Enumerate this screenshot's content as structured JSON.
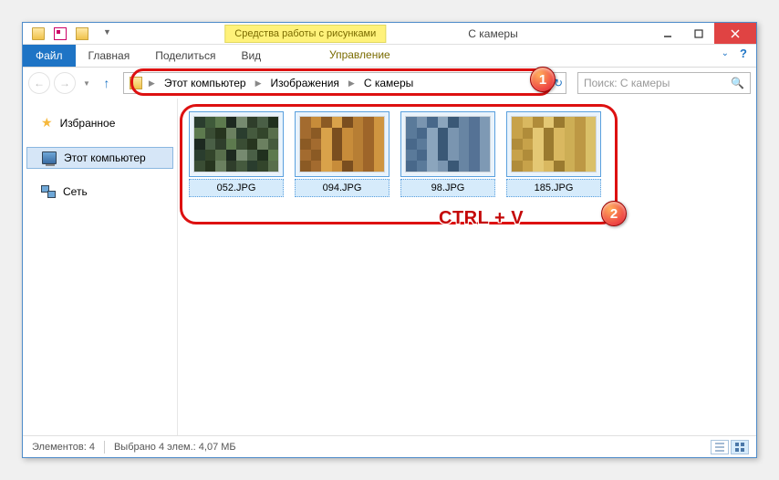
{
  "title": "С камеры",
  "contextual_tab": "Средства работы с рисунками",
  "ribbon": {
    "file": "Файл",
    "home": "Главная",
    "share": "Поделиться",
    "view": "Вид",
    "manage": "Управление"
  },
  "breadcrumb": {
    "root": "Этот компьютер",
    "pictures": "Изображения",
    "folder": "С камеры"
  },
  "search": {
    "placeholder": "Поиск: С камеры"
  },
  "sidebar": {
    "favorites": "Избранное",
    "this_pc": "Этот компьютер",
    "network": "Сеть"
  },
  "files": [
    {
      "name": "052.JPG"
    },
    {
      "name": "094.JPG"
    },
    {
      "name": "98.JPG"
    },
    {
      "name": "185.JPG"
    }
  ],
  "status": {
    "count_label": "Элементов: 4",
    "selection_label": "Выбрано 4 элем.: 4,07 МБ"
  },
  "annotations": {
    "keyhint": "CTRL + V",
    "badge1": "1",
    "badge2": "2"
  },
  "thumb_palettes": [
    [
      "#2a3d2e",
      "#3f5a3a",
      "#5d7a4e",
      "#1d2920",
      "#768a70",
      "#2f3e2b",
      "#4a5f46",
      "#20301e",
      "#5d7a4e",
      "#3a4d34",
      "#27351f",
      "#6b8060",
      "#2a3d2e",
      "#455a3e",
      "#33452b",
      "#586e4c",
      "#1d2920",
      "#4a5f46",
      "#2f3e2b",
      "#5d7a4e",
      "#3a4d34",
      "#27351f",
      "#6b8060",
      "#455a3e",
      "#2a3d2e",
      "#33452b",
      "#586e4c",
      "#1d2920",
      "#768a70",
      "#4a5f46",
      "#20301e",
      "#5d7a4e",
      "#3a4d34",
      "#27351f",
      "#6b8060",
      "#2f3e2b",
      "#455a3e",
      "#2a3d2e",
      "#33452b",
      "#586e4c"
    ],
    [
      "#a36b2f",
      "#c78c3a",
      "#8b5a24",
      "#d9a24a",
      "#7a4e1f",
      "#b77e34",
      "#9e6529",
      "#cf9540",
      "#a36b2f",
      "#8b5a24",
      "#d9a24a",
      "#7a4e1f",
      "#c78c3a",
      "#b77e34",
      "#9e6529",
      "#cf9540",
      "#8b5a24",
      "#a36b2f",
      "#d9a24a",
      "#7a4e1f",
      "#c78c3a",
      "#b77e34",
      "#9e6529",
      "#cf9540",
      "#a36b2f",
      "#8b5a24",
      "#d9a24a",
      "#7a4e1f",
      "#c78c3a",
      "#b77e34",
      "#9e6529",
      "#cf9540",
      "#8b5a24",
      "#a36b2f",
      "#d9a24a",
      "#c78c3a",
      "#7a4e1f",
      "#b77e34",
      "#9e6529",
      "#cf9540"
    ],
    [
      "#5a7a9a",
      "#7a95b0",
      "#48688a",
      "#8ba5bd",
      "#3a5876",
      "#6885a3",
      "#557295",
      "#7e99b4",
      "#5a7a9a",
      "#48688a",
      "#8ba5bd",
      "#3a5876",
      "#7a95b0",
      "#6885a3",
      "#557295",
      "#7e99b4",
      "#48688a",
      "#5a7a9a",
      "#8ba5bd",
      "#3a5876",
      "#7a95b0",
      "#6885a3",
      "#557295",
      "#7e99b4",
      "#5a7a9a",
      "#48688a",
      "#8ba5bd",
      "#3a5876",
      "#7a95b0",
      "#6885a3",
      "#557295",
      "#7e99b4",
      "#48688a",
      "#5a7a9a",
      "#8ba5bd",
      "#7a95b0",
      "#3a5876",
      "#6885a3",
      "#557295",
      "#7e99b4"
    ],
    [
      "#c7a24a",
      "#d9b860",
      "#b08c3a",
      "#e4c874",
      "#9a7a2f",
      "#cdae55",
      "#bd9844",
      "#dac068",
      "#c7a24a",
      "#b08c3a",
      "#e4c874",
      "#9a7a2f",
      "#d9b860",
      "#cdae55",
      "#bd9844",
      "#dac068",
      "#b08c3a",
      "#c7a24a",
      "#e4c874",
      "#9a7a2f",
      "#d9b860",
      "#cdae55",
      "#bd9844",
      "#dac068",
      "#c7a24a",
      "#b08c3a",
      "#e4c874",
      "#9a7a2f",
      "#d9b860",
      "#cdae55",
      "#bd9844",
      "#dac068",
      "#b08c3a",
      "#c7a24a",
      "#e4c874",
      "#d9b860",
      "#9a7a2f",
      "#cdae55",
      "#bd9844",
      "#dac068"
    ]
  ]
}
